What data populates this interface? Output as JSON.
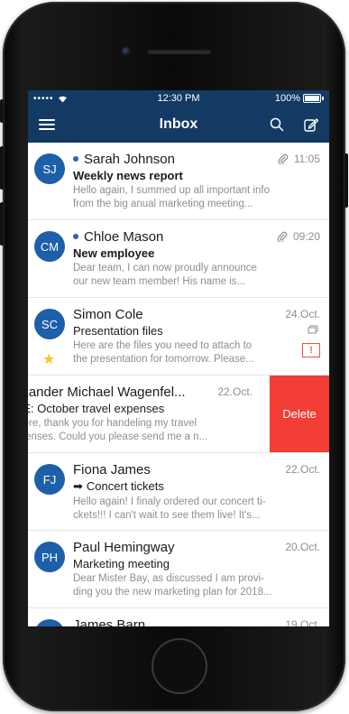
{
  "status_bar": {
    "signal": "•••••",
    "time": "12:30 PM",
    "battery": "100%"
  },
  "header": {
    "title": "Inbox"
  },
  "mails": [
    {
      "initials": "SJ",
      "sender": "Sarah Johnson",
      "unread": true,
      "attachment": true,
      "time": "11:05",
      "subject": "Weekly news report",
      "preview_line1": "Hello again, I summed up all important info",
      "preview_line2": "from the big anual marketing meeting..."
    },
    {
      "initials": "CM",
      "sender": "Chloe Mason",
      "unread": true,
      "attachment": true,
      "time": "09:20",
      "subject": "New employee",
      "preview_line1": "Dear team, I can now proudly announce",
      "preview_line2": "our new team member! His name is..."
    },
    {
      "initials": "SC",
      "sender": "Simon Cole",
      "unread": false,
      "time": "24.Oct.",
      "subject": "Presentation files",
      "preview_line1": "Here are the files you need to attach to",
      "preview_line2": "the presentation for tomorrow. Please...",
      "flag_text": "!"
    },
    {
      "sender": "exander Michael Wagenfel...",
      "time": "22.Oct.",
      "subject": "RE: October travel expenses",
      "preview_line1": "there, thank you for handeling my travel",
      "preview_line2": "xpenses. Could you please send me a n...",
      "delete_label": "Delete"
    },
    {
      "initials": "FJ",
      "sender": "Fiona James",
      "time": "22.Oct.",
      "subject": "Concert tickets",
      "forward_arrow": "➡",
      "preview_line1": "Hello again! I finaly ordered our concert ti-",
      "preview_line2": "ckets!!! I can't wait to see them live! It's..."
    },
    {
      "initials": "PH",
      "sender": "Paul Hemingway",
      "time": "20.Oct.",
      "subject": "Marketing meeting",
      "preview_line1": "Dear Mister Bay, as discussed I am provi-",
      "preview_line2": "ding you the new marketing plan for 2018..."
    },
    {
      "initials": "",
      "sender": "James Barn",
      "time": "19.Oct."
    }
  ],
  "colors": {
    "header": "#123a63",
    "avatar": "#1d5fa9",
    "delete": "#f23e36",
    "star": "#f5c52a",
    "flag": "#e25544"
  }
}
